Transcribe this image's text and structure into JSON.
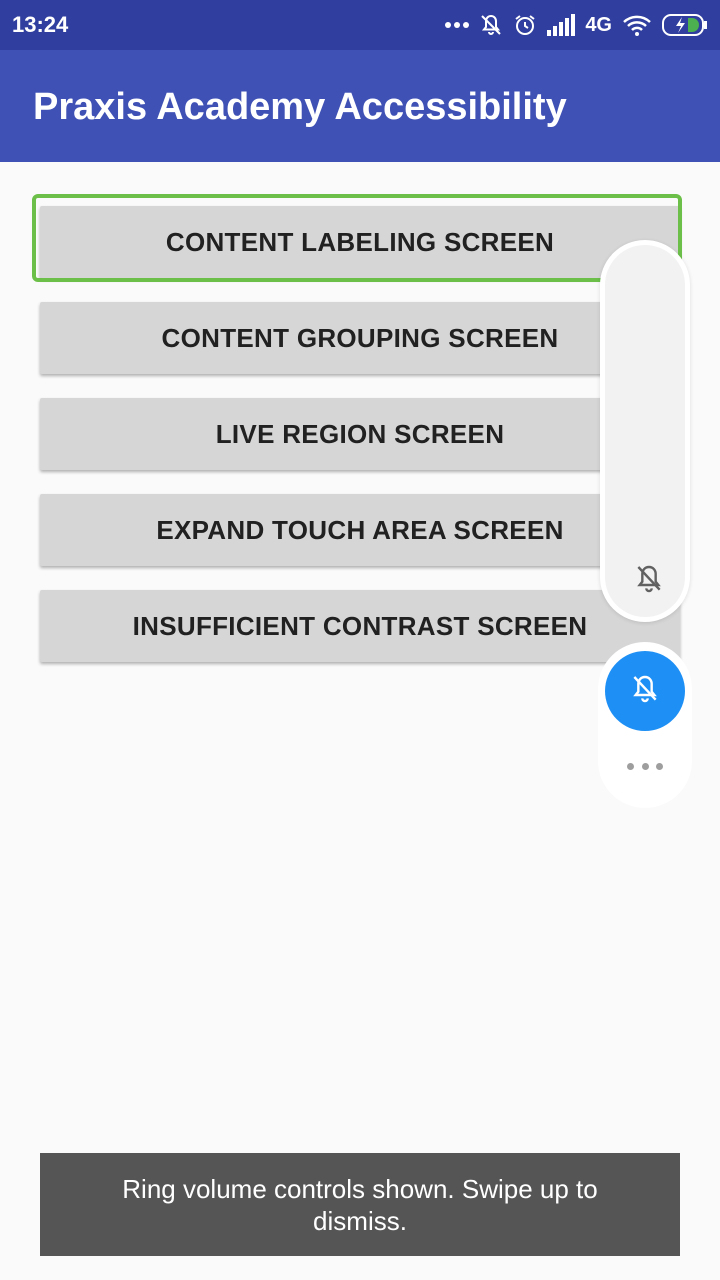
{
  "status_bar": {
    "time": "13:24",
    "network": "4G",
    "icons": [
      "more-dots-icon",
      "notifications-off-icon",
      "alarm-icon",
      "signal-icon",
      "wifi-icon",
      "battery-charging-icon"
    ]
  },
  "app_bar": {
    "title": "Praxis Academy Accessibility"
  },
  "menu": {
    "buttons": [
      {
        "label": "CONTENT LABELING SCREEN",
        "focused": true
      },
      {
        "label": "CONTENT GROUPING SCREEN"
      },
      {
        "label": "LIVE REGION SCREEN"
      },
      {
        "label": "EXPAND TOUCH AREA SCREEN"
      },
      {
        "label": "INSUFFICIENT CONTRAST SCREEN"
      }
    ]
  },
  "volume_panel": {
    "icons": [
      "bell-off-icon",
      "bell-off-icon",
      "more-options-icon"
    ],
    "accent_color": "#1e90f5"
  },
  "toast": {
    "message": "Ring volume controls shown. Swipe up to dismiss."
  },
  "colors": {
    "status_bar": "#303f9f",
    "app_bar": "#3f51b5",
    "focus_ring": "#6cc04a",
    "button_bg": "#d6d6d6"
  }
}
